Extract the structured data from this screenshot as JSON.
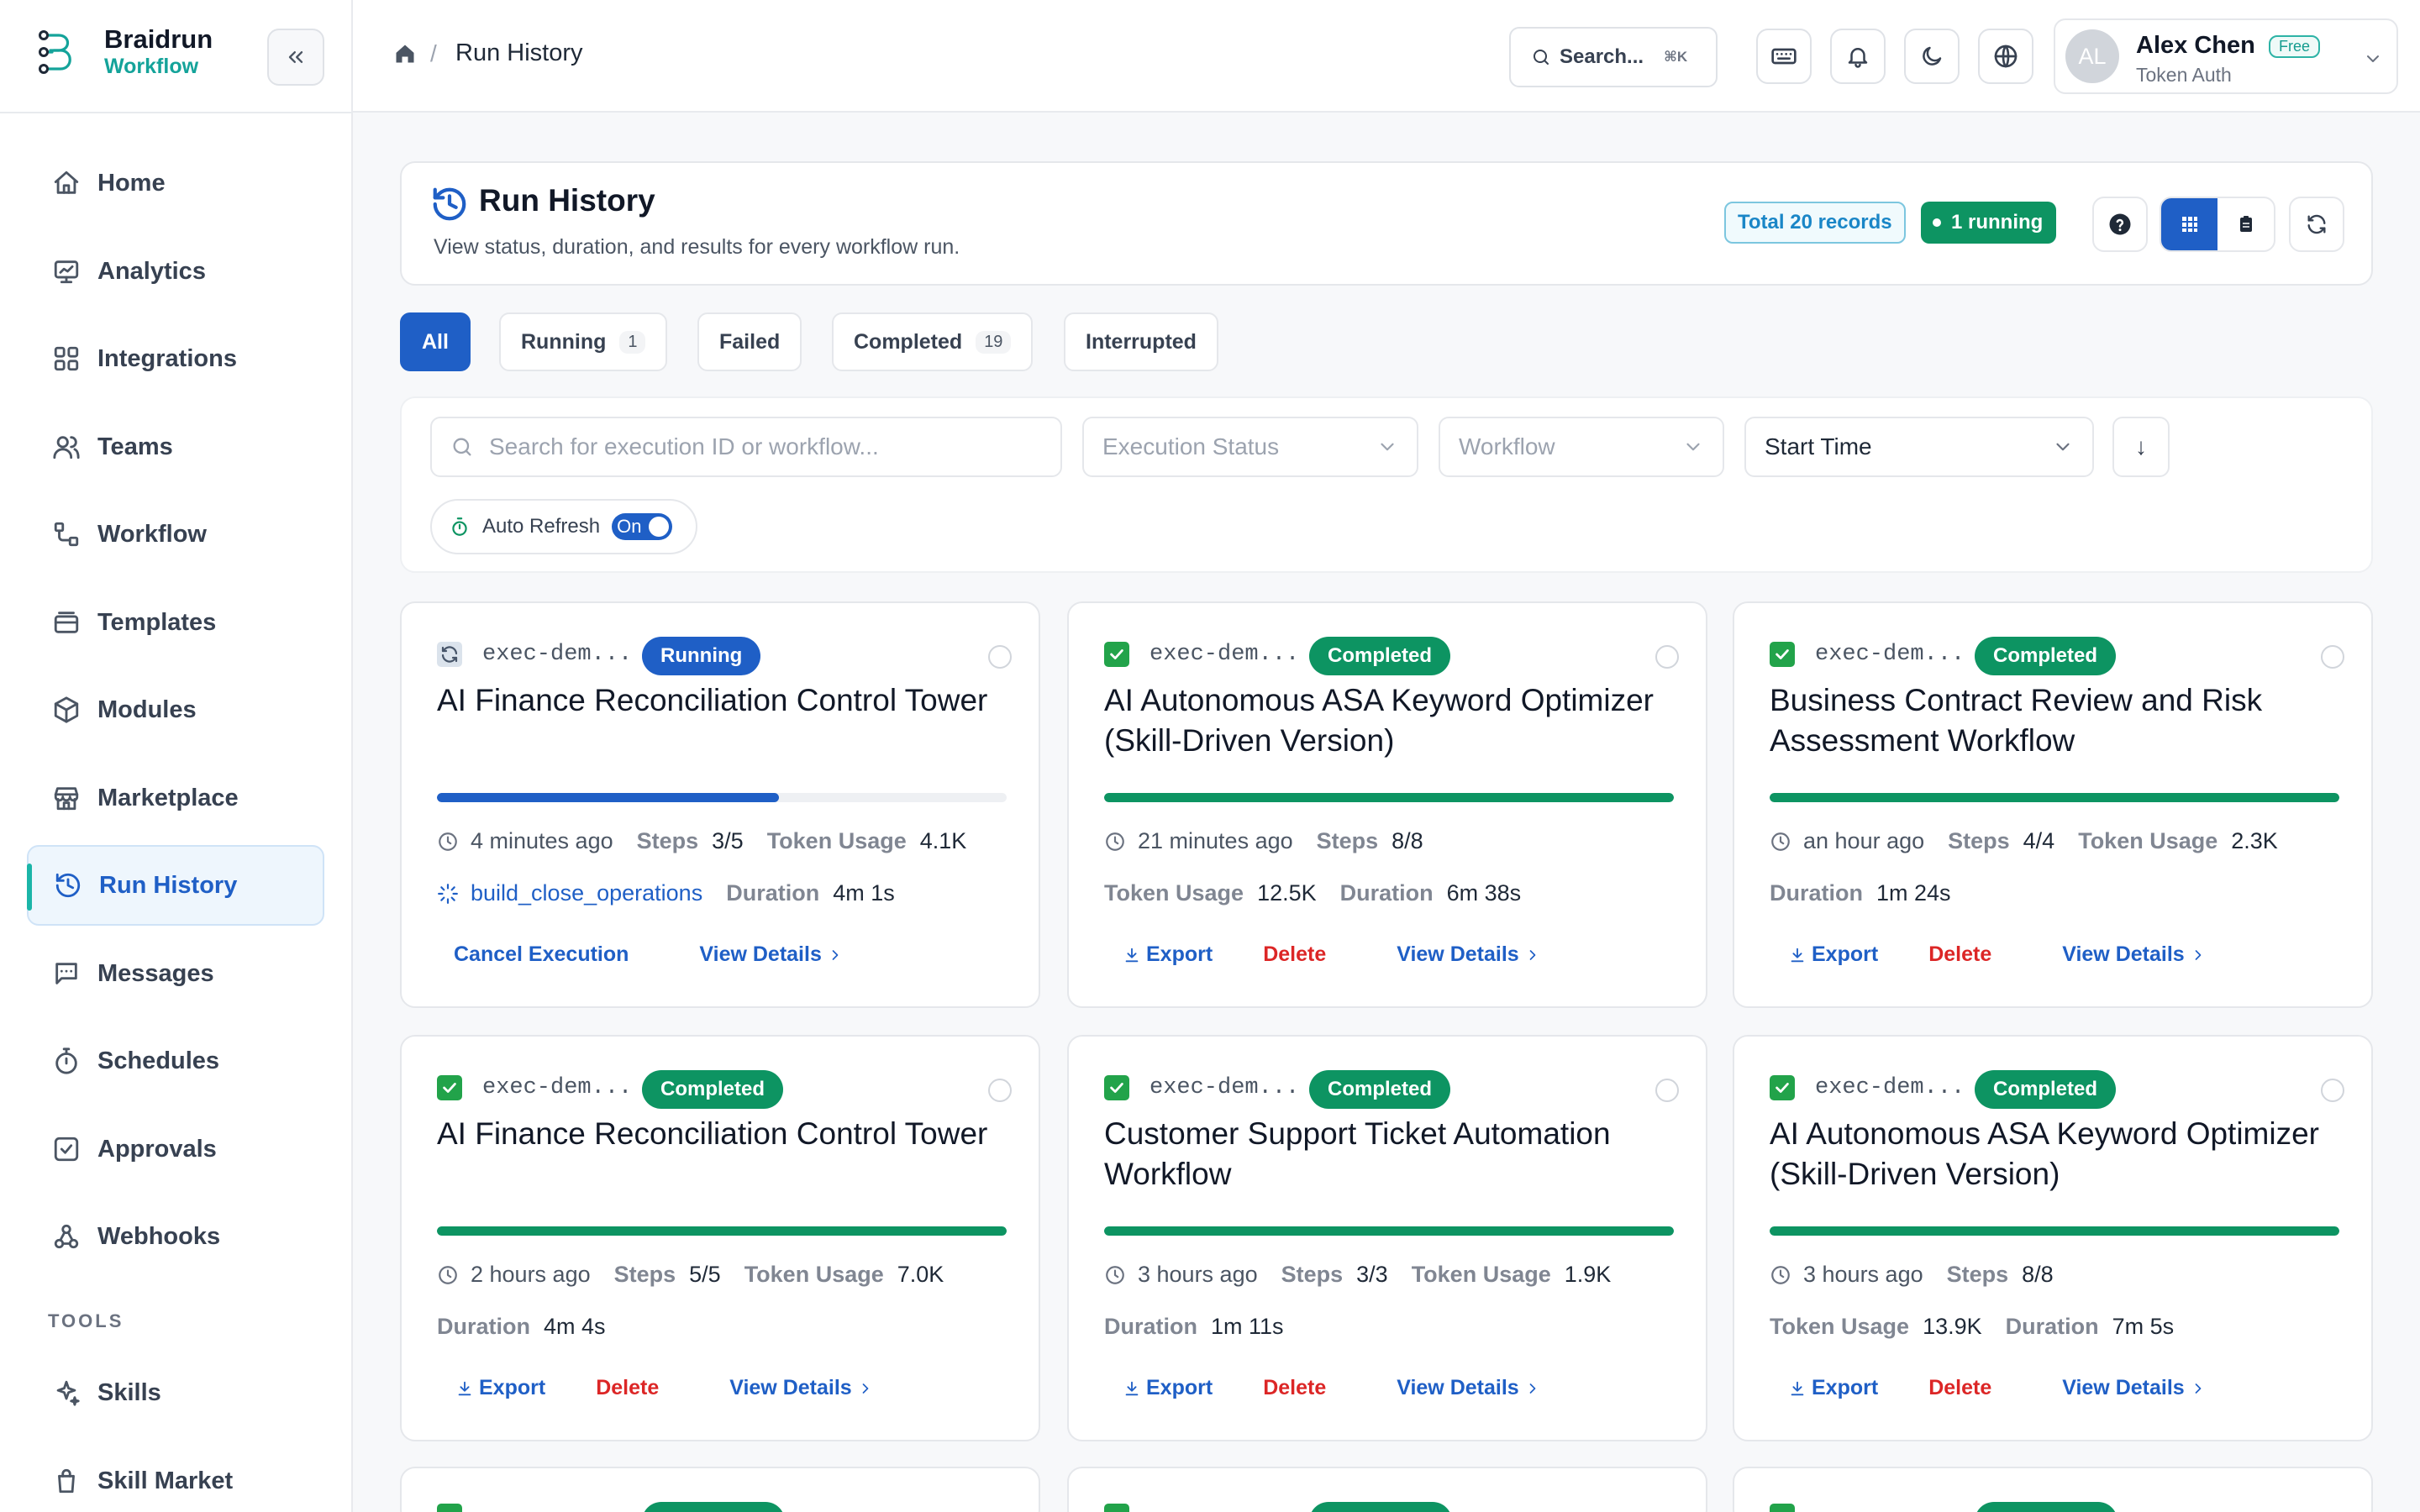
{
  "brand": {
    "name": "Braidrun",
    "sub": "Workflow"
  },
  "nav": [
    {
      "label": "Home",
      "icon": "home-icon"
    },
    {
      "label": "Analytics",
      "icon": "analytics-icon"
    },
    {
      "label": "Integrations",
      "icon": "integrations-icon"
    },
    {
      "label": "Teams",
      "icon": "teams-icon"
    },
    {
      "label": "Workflow",
      "icon": "workflow-icon"
    },
    {
      "label": "Templates",
      "icon": "templates-icon"
    },
    {
      "label": "Modules",
      "icon": "modules-icon"
    },
    {
      "label": "Marketplace",
      "icon": "marketplace-icon"
    },
    {
      "label": "Run History",
      "icon": "history-icon",
      "active": true
    },
    {
      "label": "Messages",
      "icon": "messages-icon"
    },
    {
      "label": "Schedules",
      "icon": "schedules-icon"
    },
    {
      "label": "Approvals",
      "icon": "approvals-icon"
    },
    {
      "label": "Webhooks",
      "icon": "webhooks-icon"
    }
  ],
  "tools_label": "TOOLS",
  "tools": [
    {
      "label": "Skills",
      "icon": "skills-icon"
    },
    {
      "label": "Skill Market",
      "icon": "skill-market-icon"
    }
  ],
  "breadcrumb": {
    "current": "Run History"
  },
  "topbar": {
    "search_label": "Search...",
    "search_shortcut": "⌘K"
  },
  "user": {
    "name": "Alex Chen",
    "badge": "Free",
    "auth": "Token Auth",
    "initials": "AL"
  },
  "header": {
    "title": "Run History",
    "description": "View status, duration, and results for every workflow run.",
    "total_badge": "Total 20 records",
    "running_badge": "1 running"
  },
  "tabs": [
    {
      "label": "All",
      "count": "",
      "active": true
    },
    {
      "label": "Running",
      "count": "1"
    },
    {
      "label": "Failed",
      "count": ""
    },
    {
      "label": "Completed",
      "count": "19"
    },
    {
      "label": "Interrupted",
      "count": ""
    }
  ],
  "filters": {
    "search_placeholder": "Search for execution ID or workflow...",
    "status_placeholder": "Execution Status",
    "workflow_placeholder": "Workflow",
    "sort_field": "Start Time",
    "sort_dir": "↓",
    "auto_refresh_label": "Auto Refresh",
    "auto_refresh_state": "On"
  },
  "labels": {
    "steps": "Steps",
    "token_usage": "Token Usage",
    "duration": "Duration",
    "cancel": "Cancel Execution",
    "view": "View Details",
    "export": "Export",
    "delete": "Delete"
  },
  "colors": {
    "primary": "#1f5fc6",
    "success": "#0d9462",
    "danger": "#dc2626",
    "accent": "#14a39a"
  },
  "runs": [
    {
      "exec_id": "exec-dem...",
      "status": "Running",
      "title": "AI Finance Reconciliation Control Tower",
      "progress": 0.6,
      "time": "4 minutes ago",
      "steps": "3/5",
      "tokens": "4.1K",
      "node": "build_close_operations",
      "duration": "4m 1s"
    },
    {
      "exec_id": "exec-dem...",
      "status": "Completed",
      "title": "AI Autonomous ASA Keyword Optimizer (Skill-Driven Version)",
      "progress": 1,
      "time": "21 minutes ago",
      "steps": "8/8",
      "tokens": "12.5K",
      "duration": "6m 38s"
    },
    {
      "exec_id": "exec-dem...",
      "status": "Completed",
      "title": "Business Contract Review and Risk Assessment Workflow",
      "progress": 1,
      "time": "an hour ago",
      "steps": "4/4",
      "tokens": "2.3K",
      "duration": "1m 24s"
    },
    {
      "exec_id": "exec-dem...",
      "status": "Completed",
      "title": "AI Finance Reconciliation Control Tower",
      "progress": 1,
      "time": "2 hours ago",
      "steps": "5/5",
      "tokens": "7.0K",
      "duration": "4m 4s"
    },
    {
      "exec_id": "exec-dem...",
      "status": "Completed",
      "title": "Customer Support Ticket Automation Workflow",
      "progress": 1,
      "time": "3 hours ago",
      "steps": "3/3",
      "tokens": "1.9K",
      "duration": "1m 11s"
    },
    {
      "exec_id": "exec-dem...",
      "status": "Completed",
      "title": "AI Autonomous ASA Keyword Optimizer (Skill-Driven Version)",
      "progress": 1,
      "time": "3 hours ago",
      "steps": "8/8",
      "tokens": "13.9K",
      "duration": "7m 5s"
    }
  ]
}
